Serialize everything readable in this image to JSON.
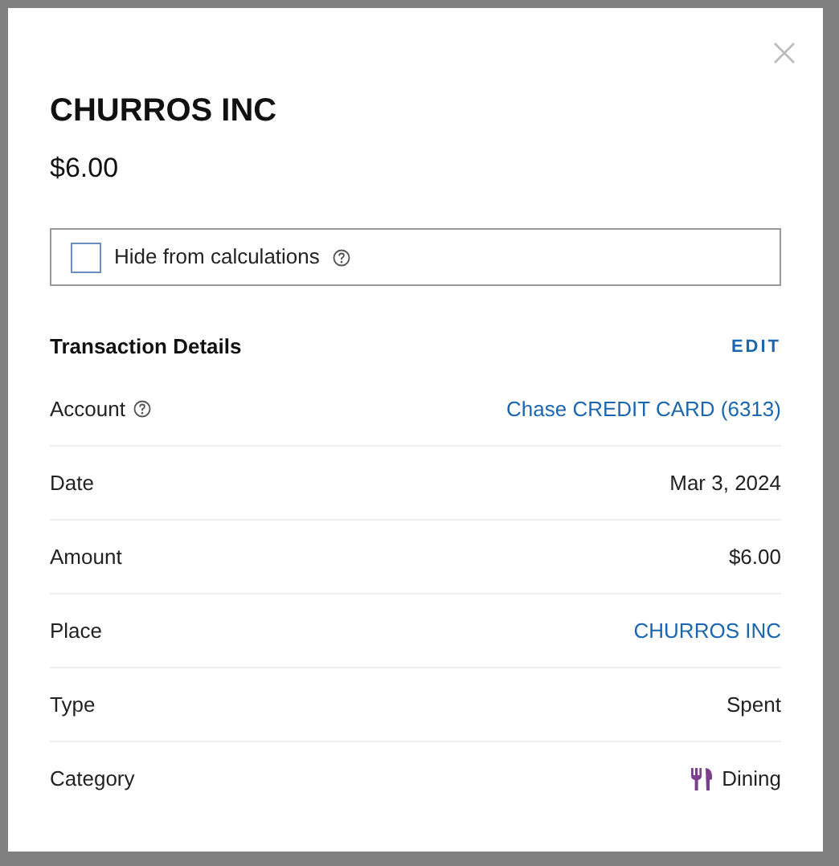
{
  "dialog": {
    "title": "CHURROS INC",
    "amount": "$6.00",
    "hide_option": {
      "label": "Hide from calculations",
      "checked": false
    },
    "section": {
      "title": "Transaction Details",
      "action": "EDIT"
    },
    "details": [
      {
        "label": "Account",
        "info_icon": true,
        "value": "Chase CREDIT CARD (6313)",
        "kind": "link"
      },
      {
        "label": "Date",
        "info_icon": false,
        "value": "Mar 3, 2024",
        "kind": "text"
      },
      {
        "label": "Amount",
        "info_icon": false,
        "value": "$6.00",
        "kind": "text"
      },
      {
        "label": "Place",
        "info_icon": false,
        "value": "CHURROS INC",
        "kind": "link"
      },
      {
        "label": "Type",
        "info_icon": false,
        "value": "Spent",
        "kind": "text"
      },
      {
        "label": "Category",
        "info_icon": false,
        "value": "Dining",
        "kind": "category",
        "color": "#7b3f8c"
      }
    ]
  }
}
